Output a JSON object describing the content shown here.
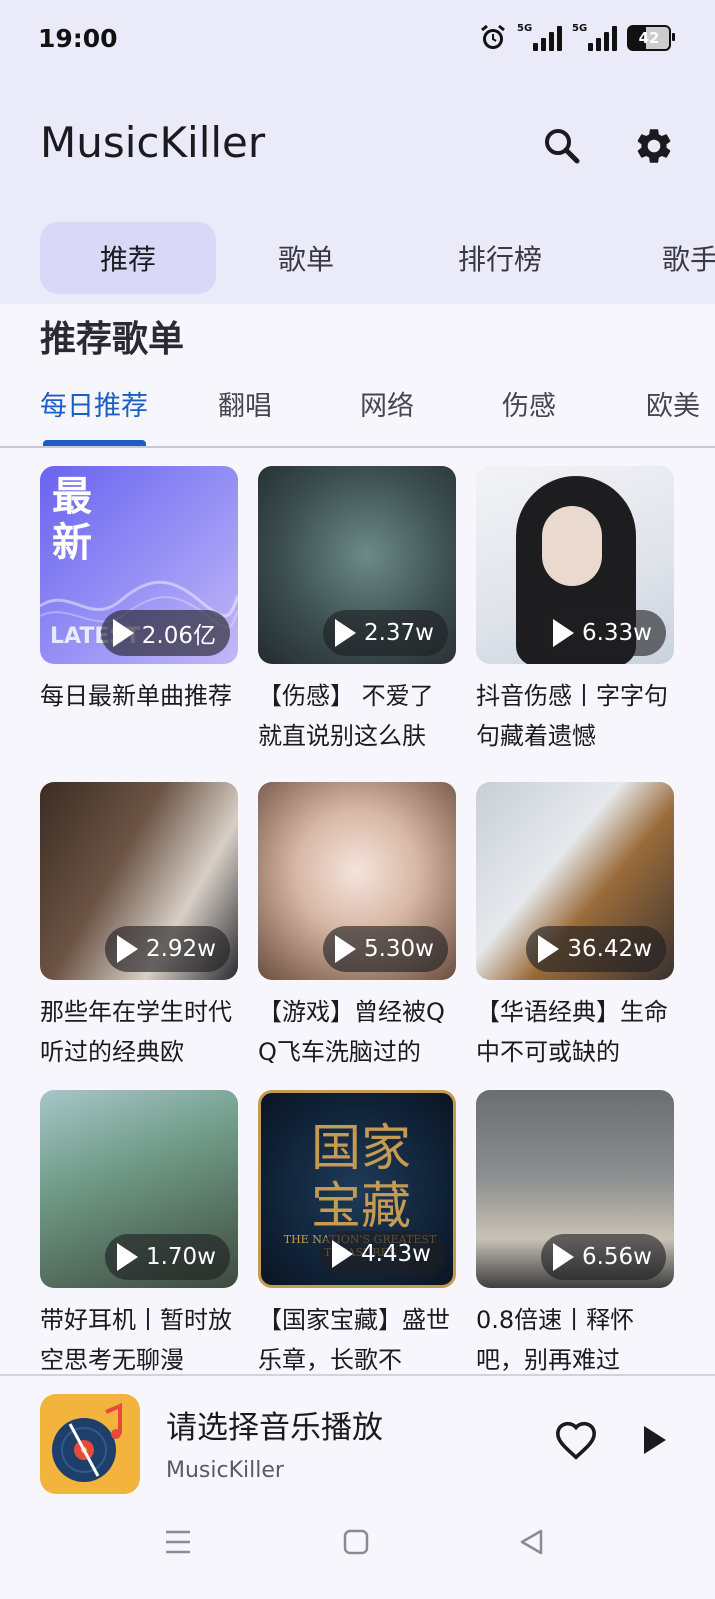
{
  "status": {
    "time": "19:00",
    "signal1": "5G",
    "signal2": "5G",
    "battery": "42"
  },
  "app": {
    "title": "MusicKiller"
  },
  "top_tabs": [
    "推荐",
    "歌单",
    "排行榜",
    "歌手"
  ],
  "section": {
    "title": "推荐歌单"
  },
  "sub_tabs": [
    "每日推荐",
    "翻唱",
    "网络",
    "伤感",
    "欧美"
  ],
  "playlists": [
    {
      "title": "每日最新单曲推荐",
      "plays": "2.06亿",
      "cover_text": "最新",
      "cover_sub": "LATEST"
    },
    {
      "title": "【伤感】 不爱了就直说别这么肤",
      "plays": "2.37w"
    },
    {
      "title": "抖音伤感丨字字句句藏着遗憾",
      "plays": "6.33w"
    },
    {
      "title": "那些年在学生时代听过的经典欧",
      "plays": "2.92w"
    },
    {
      "title": "【游戏】曾经被QQ飞车洗脑过的",
      "plays": "5.30w"
    },
    {
      "title": "【华语经典】生命中不可或缺的",
      "plays": "36.42w"
    },
    {
      "title": "带好耳机丨暂时放空思考无聊漫",
      "plays": "1.70w"
    },
    {
      "title": "【国家宝藏】盛世乐章，长歌不",
      "plays": "4.43w",
      "cover_text": "国家宝藏",
      "cover_sub": "THE NATION'S GREATEST TREASURES"
    },
    {
      "title": "0.8倍速丨释怀吧，别再难过",
      "plays": "6.56w"
    }
  ],
  "player": {
    "title": "请选择音乐播放",
    "subtitle": "MusicKiller"
  },
  "colors": {
    "accent": "#1c5fc4",
    "header_bg": "#ebeaf8",
    "active_tab_bg": "#dad8f7"
  }
}
